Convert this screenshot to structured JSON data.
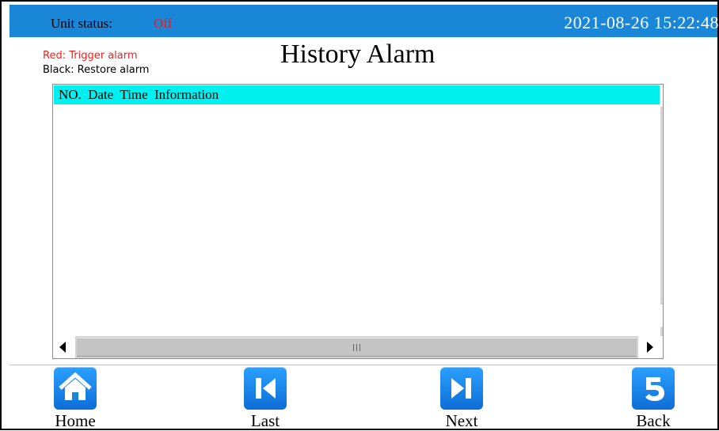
{
  "header": {
    "status_label": "Unit status:",
    "status_value": "Off",
    "datetime": "2021-08-26  15:22:48"
  },
  "legend": {
    "red": "Red: Trigger alarm",
    "black": "Black: Restore alarm"
  },
  "page_title": "History Alarm",
  "table": {
    "columns": [
      "NO.",
      "Date",
      "Time",
      "Information"
    ],
    "rows": []
  },
  "nav": {
    "home": "Home",
    "last": "Last",
    "next": "Next",
    "back": "Back"
  },
  "colors": {
    "topbar": "#1a86d8",
    "header_row": "#00f0f0",
    "status_off": "#e02020",
    "trigger": "#ff1a1a"
  }
}
